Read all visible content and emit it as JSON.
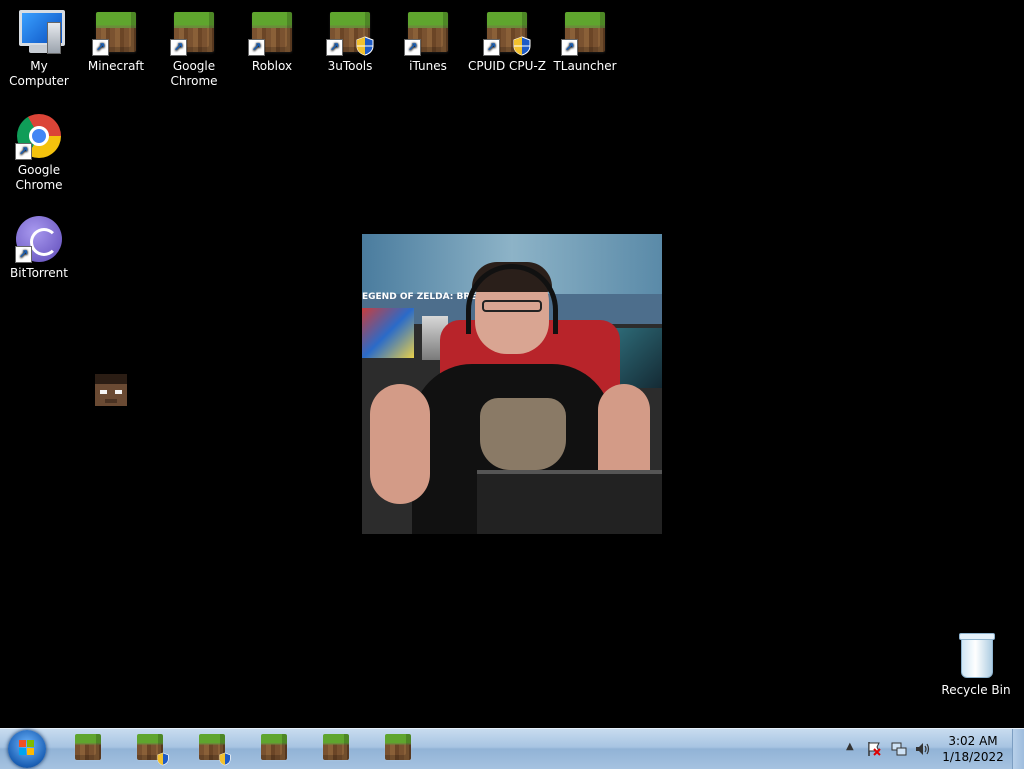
{
  "desktop": {
    "icons": [
      {
        "label": "My Computer",
        "icon": "computer-icon"
      },
      {
        "label": "Minecraft",
        "icon": "minecraft-grass-block-icon",
        "shortcut": true
      },
      {
        "label": "Google Chrome",
        "icon": "minecraft-grass-block-icon",
        "shortcut": true
      },
      {
        "label": "Roblox",
        "icon": "minecraft-grass-block-icon",
        "shortcut": true
      },
      {
        "label": "3uTools",
        "icon": "minecraft-grass-block-icon",
        "shortcut": true,
        "uac_shield": true
      },
      {
        "label": "iTunes",
        "icon": "minecraft-grass-block-icon",
        "shortcut": true
      },
      {
        "label": "CPUID CPU-Z",
        "icon": "minecraft-grass-block-icon",
        "shortcut": true,
        "uac_shield": true
      },
      {
        "label": "TLauncher",
        "icon": "minecraft-grass-block-icon",
        "shortcut": true
      },
      {
        "label": "Google Chrome",
        "icon": "chrome-icon",
        "shortcut": true
      },
      {
        "label": "BitTorrent",
        "icon": "bittorrent-icon",
        "shortcut": true
      },
      {
        "label": "Recycle Bin",
        "icon": "recycle-bin-icon"
      }
    ],
    "wallpaper_photo_banner": "EGEND OF ZELDA: BREATH OF T"
  },
  "taskbar": {
    "pinned": [
      {
        "icon": "minecraft-grass-block-icon"
      },
      {
        "icon": "minecraft-grass-block-icon",
        "uac_shield": true
      },
      {
        "icon": "minecraft-grass-block-icon",
        "uac_shield": true
      },
      {
        "icon": "minecraft-grass-block-icon"
      },
      {
        "icon": "minecraft-grass-block-icon"
      },
      {
        "icon": "minecraft-grass-block-icon"
      }
    ],
    "tray": {
      "show_hidden": "▲",
      "time": "3:02 AM",
      "date": "1/18/2022"
    }
  },
  "colors": {
    "desktop_bg": "#000000",
    "taskbar": "#a7c4e2",
    "grass": "#5fa52e",
    "dirt": "#7a5230"
  }
}
